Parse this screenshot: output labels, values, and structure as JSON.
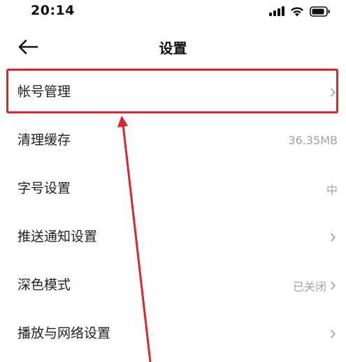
{
  "status_bar": {
    "time": "20:14"
  },
  "header": {
    "title": "设置"
  },
  "menu": [
    {
      "label": "帐号管理",
      "value": ""
    },
    {
      "label": "清理缓存",
      "value": "36.35MB"
    },
    {
      "label": "字号设置",
      "value": "中"
    },
    {
      "label": "推送通知设置",
      "value": ""
    },
    {
      "label": "深色模式",
      "value": "已关闭"
    },
    {
      "label": "播放与网络设置",
      "value": ""
    }
  ],
  "colors": {
    "annotation": "#e2232a",
    "secondary_text": "#a3a3a3"
  }
}
